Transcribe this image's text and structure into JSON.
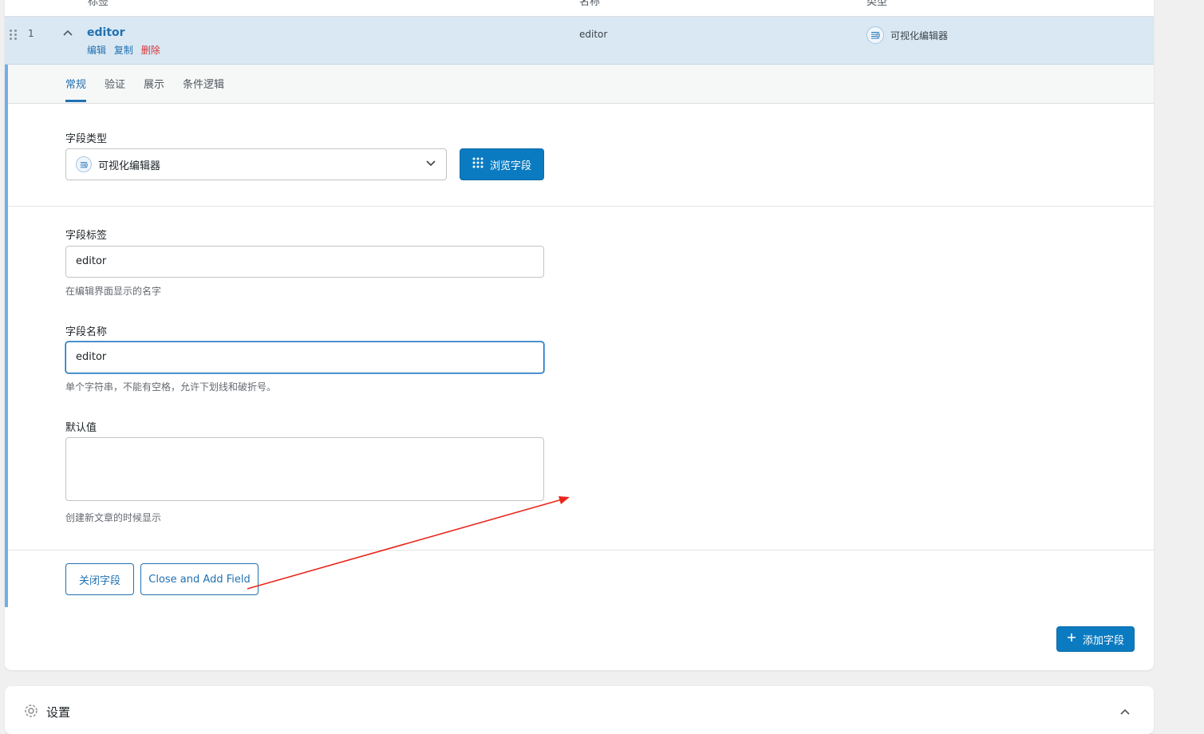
{
  "table_header": {
    "col_label": "标签",
    "col_name": "名称",
    "col_type": "类型"
  },
  "field_row": {
    "order": "1",
    "label": "editor",
    "actions": {
      "edit": "编辑",
      "duplicate": "复制",
      "delete": "删除"
    },
    "name": "editor",
    "type": "可视化编辑器"
  },
  "tabs": [
    {
      "label": "常规",
      "active": true
    },
    {
      "label": "验证",
      "active": false
    },
    {
      "label": "展示",
      "active": false
    },
    {
      "label": "条件逻辑",
      "active": false
    }
  ],
  "field_type": {
    "label": "字段类型",
    "selected": "可视化编辑器",
    "browse_button": "浏览字段"
  },
  "field_label": {
    "label": "字段标签",
    "value": "editor",
    "hint": "在编辑界面显示的名字"
  },
  "field_name": {
    "label": "字段名称",
    "value": "editor",
    "hint": "单个字符串，不能有空格，允许下划线和破折号。"
  },
  "default_value": {
    "label": "默认值",
    "value": "",
    "hint": "创建新文章的时候显示"
  },
  "footer_buttons": {
    "close_field": "关闭字段",
    "close_and_add": "Close and Add Field"
  },
  "add_field_button": "添加字段",
  "settings_section": {
    "title": "设置"
  },
  "colors": {
    "accent": "#2271b1",
    "primary_button": "#0b7bc1",
    "row_highlight": "#d9e8f3",
    "delete": "#d63638",
    "annotation_arrow": "#e8261c"
  }
}
